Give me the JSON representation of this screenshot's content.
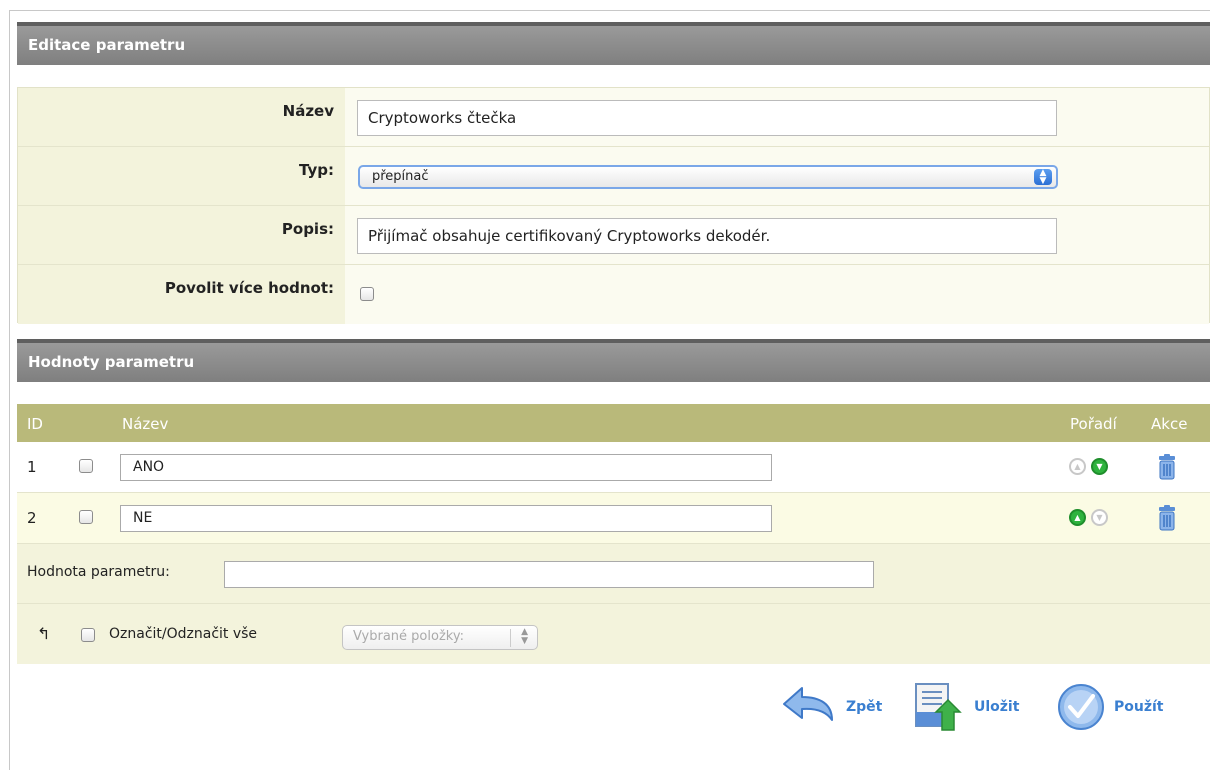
{
  "edit_section": {
    "title": "Editace parametru",
    "name_label": "Název",
    "name_value": "Cryptoworks čtečka",
    "type_label": "Typ:",
    "type_value": "přepínač",
    "desc_label": "Popis:",
    "desc_value": "Přijímač obsahuje certifikovaný Cryptoworks dekodér.",
    "multi_label": "Povolit více hodnot:",
    "multi_checked": false
  },
  "values_section": {
    "title": "Hodnoty parametru",
    "columns": {
      "id": "ID",
      "name": "Název",
      "order": "Pořadí",
      "action": "Akce"
    },
    "rows": [
      {
        "id": "1",
        "value": "ANO",
        "up_enabled": false,
        "down_enabled": true
      },
      {
        "id": "2",
        "value": "NE",
        "up_enabled": true,
        "down_enabled": false
      }
    ],
    "new_value_label": "Hodnota parametru:",
    "new_value": "",
    "select_all_label": "Označit/Odznačit vše",
    "bulk_select": "Vybrané položky:"
  },
  "actions": {
    "back": "Zpět",
    "save": "Uložit",
    "apply": "Použít"
  },
  "colors": {
    "header_gray": "#8a8a8a",
    "olive_header": "#b9b97a",
    "link_blue": "#3a7fd0",
    "green": "#2eb33e"
  }
}
